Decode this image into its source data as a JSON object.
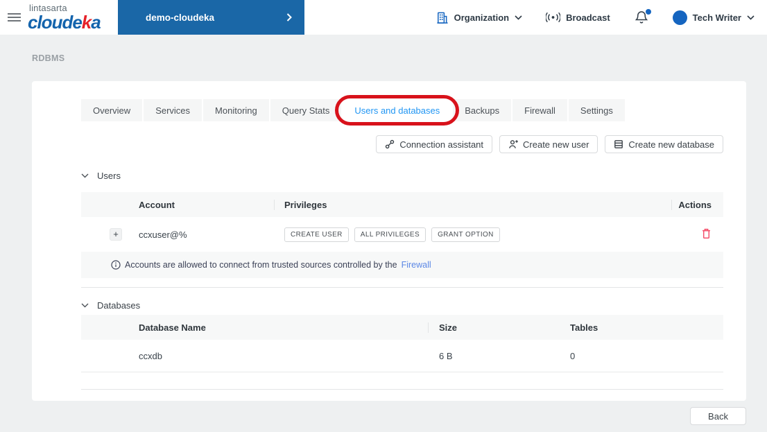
{
  "colors": {
    "brand_blue": "#1464ad",
    "brand_red": "#e62129",
    "project_bar_blue": "#1a67a7",
    "accent_blue": "#1565c0",
    "active_tab_blue": "#2196f3",
    "annotation_red": "#d8121b",
    "delete_red": "#f4516c",
    "link_blue": "#5b87e5"
  },
  "header": {
    "brand_top": "lintasarta",
    "brand_1": "cloude",
    "brand_k": "k",
    "brand_2": "a",
    "project_name": "demo-cloudeka",
    "project_chevron": "›",
    "organization_label": "Organization",
    "broadcast_label": "Broadcast",
    "user_name": "Tech Writer"
  },
  "breadcrumb": "RDBMS",
  "tabs": [
    "Overview",
    "Services",
    "Monitoring",
    "Query Stats",
    "Users and databases",
    "Backups",
    "Firewall",
    "Settings"
  ],
  "active_tab": "Users and databases",
  "toolbar": {
    "connection_assistant": "Connection assistant",
    "create_user": "Create new user",
    "create_database": "Create new database"
  },
  "users": {
    "title": "Users",
    "columns": {
      "account": "Account",
      "privileges": "Privileges",
      "actions": "Actions"
    },
    "row": {
      "expand": "+",
      "account": "ccxuser@%",
      "privileges": [
        "CREATE USER",
        "ALL PRIVILEGES",
        "GRANT OPTION"
      ]
    },
    "note_text": "Accounts are allowed to connect from trusted sources controlled by the",
    "note_link": "Firewall"
  },
  "databases": {
    "title": "Databases",
    "columns": {
      "name": "Database Name",
      "size": "Size",
      "tables": "Tables"
    },
    "row": {
      "name": "ccxdb",
      "size": "6 B",
      "tables": "0"
    }
  },
  "back_label": "Back"
}
